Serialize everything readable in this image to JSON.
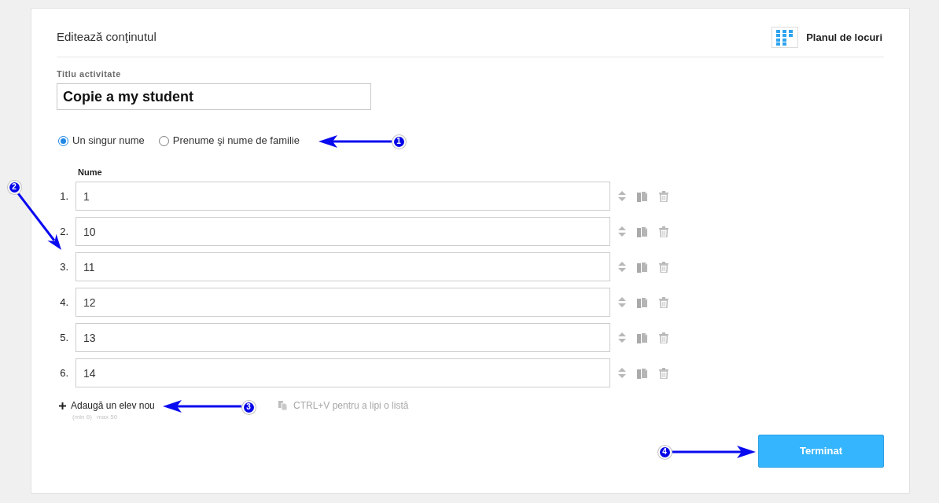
{
  "header": {
    "title": "Editează conţinutul",
    "seating_plan_link": "Planul de locuri"
  },
  "activity_title": {
    "label": "Titlu activitate",
    "value": "Copie a my student"
  },
  "name_format": [
    {
      "label": "Un singur nume",
      "selected": true
    },
    {
      "label": "Prenume şi nume de familie",
      "selected": false
    }
  ],
  "students": {
    "column": "Nume",
    "rows": [
      {
        "number": "1.",
        "value": "1"
      },
      {
        "number": "2.",
        "value": "10"
      },
      {
        "number": "3.",
        "value": "11"
      },
      {
        "number": "4.",
        "value": "12"
      },
      {
        "number": "5.",
        "value": "13"
      },
      {
        "number": "6.",
        "value": "14"
      }
    ]
  },
  "add_student": {
    "label": "Adaugă un elev nou",
    "min": "(min 6)",
    "max": "max 50"
  },
  "paste_hint": "CTRL+V pentru a lipi o listă",
  "done_button": "Terminat",
  "annotations": [
    {
      "number": "1"
    },
    {
      "number": "2"
    },
    {
      "number": "3"
    },
    {
      "number": "4"
    }
  ]
}
